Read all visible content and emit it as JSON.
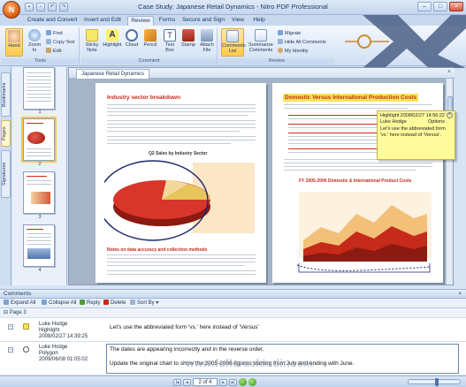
{
  "window": {
    "title": "Case Study: Japanese Retail Dynamics - Nitro PDF Professional",
    "orb_glyph": "N"
  },
  "tabs": [
    "Create and Convert",
    "Insert and Edit",
    "Review",
    "Forms",
    "Secure and Sign",
    "View",
    "Help"
  ],
  "active_tab": "Review",
  "ribbon": {
    "tools_group": "Tools",
    "hand": "Hand",
    "zoom": "Zoom In",
    "find": "Find",
    "copy_text": "Copy Text",
    "edit": "Edit",
    "comment_group": "Comment",
    "sticky_note": "Sticky Note",
    "highlight": "Highlight",
    "cloud": "Cloud",
    "pencil": "Pencil",
    "text_box": "Text Box",
    "stamp": "Stamp",
    "attach_file": "Attach File",
    "review_group": "Review",
    "comments_list": "Comments List",
    "summarize": "Summarize Comments",
    "migrate": "Migrate",
    "hide_all": "Hide All Comments",
    "my_identity": "My Identity"
  },
  "sidetabs": [
    "Bookmarks",
    "Pages",
    "Signatures"
  ],
  "thumbnails": [
    {
      "num": "1"
    },
    {
      "num": "2"
    },
    {
      "num": "3"
    },
    {
      "num": "4"
    }
  ],
  "document": {
    "tab_label": "Japanese Retail Dynamics",
    "page1": {
      "heading": "Industry sector breakdown",
      "chart_title": "Q2 Sales by Industry Sector",
      "subheading": "Notes on data accuracy and collection methods"
    },
    "page2": {
      "heading": "Domestic Versus International Production Costs",
      "chart_title": "FY 2005-2006 Domestic & International Product Costs"
    }
  },
  "note": {
    "type": "Highlight",
    "date": "2008/02/27 14:56:22",
    "author": "Luke Hodge",
    "options": "Options",
    "text": "Let's use the abbreviated form 'vs.' here instead of 'Versus'."
  },
  "comments": {
    "panel_title": "Comments",
    "toolbar": [
      "Expand All",
      "Collapse All",
      "Reply",
      "Delete",
      "Sort By"
    ],
    "page_label": "Page 3",
    "items": [
      {
        "author": "Luke Hodge",
        "type": "Highlight",
        "date": "2008/02/27 14:39:25",
        "text": "Let's use the abbreviated form 'vs.' here instead of 'Versus'"
      },
      {
        "author": "Luke Hodge",
        "type": "Polygon",
        "date": "2009/06/08 01:05:02",
        "text": "The dates are appearing incorrectly and in the reverse order.",
        "text2": "Update the original chart to show the 2005-2006 figures starting from July and ending with June."
      }
    ]
  },
  "status": {
    "page_indicator": "2 of 4"
  },
  "watermark": "www.fullcrackindir.com",
  "colors": {
    "accent": "#ffc94d",
    "heading_red": "#c62a1a",
    "note_yellow": "#fffb9c"
  }
}
